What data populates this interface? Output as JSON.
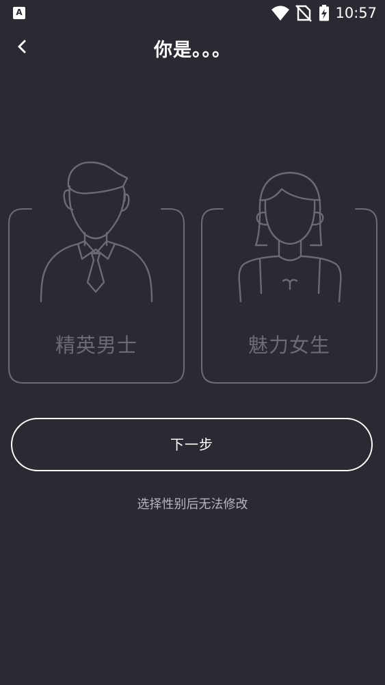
{
  "status_bar": {
    "app_icon_letter": "A",
    "time": "10:57",
    "icons": [
      "wifi-icon",
      "no-sim-icon",
      "battery-charging-icon"
    ]
  },
  "header": {
    "back_icon": "chevron-left-icon",
    "title": "你是。。。"
  },
  "genders": [
    {
      "label": "精英男士",
      "icon": "male-avatar-icon"
    },
    {
      "label": "魅力女生",
      "icon": "female-avatar-icon"
    }
  ],
  "next_button": {
    "label": "下一步"
  },
  "hint": "选择性别后无法修改",
  "colors": {
    "background": "#2b2a33",
    "outline": "#6c6b75",
    "text": "#ffffff",
    "hint": "#b7b6bf"
  }
}
